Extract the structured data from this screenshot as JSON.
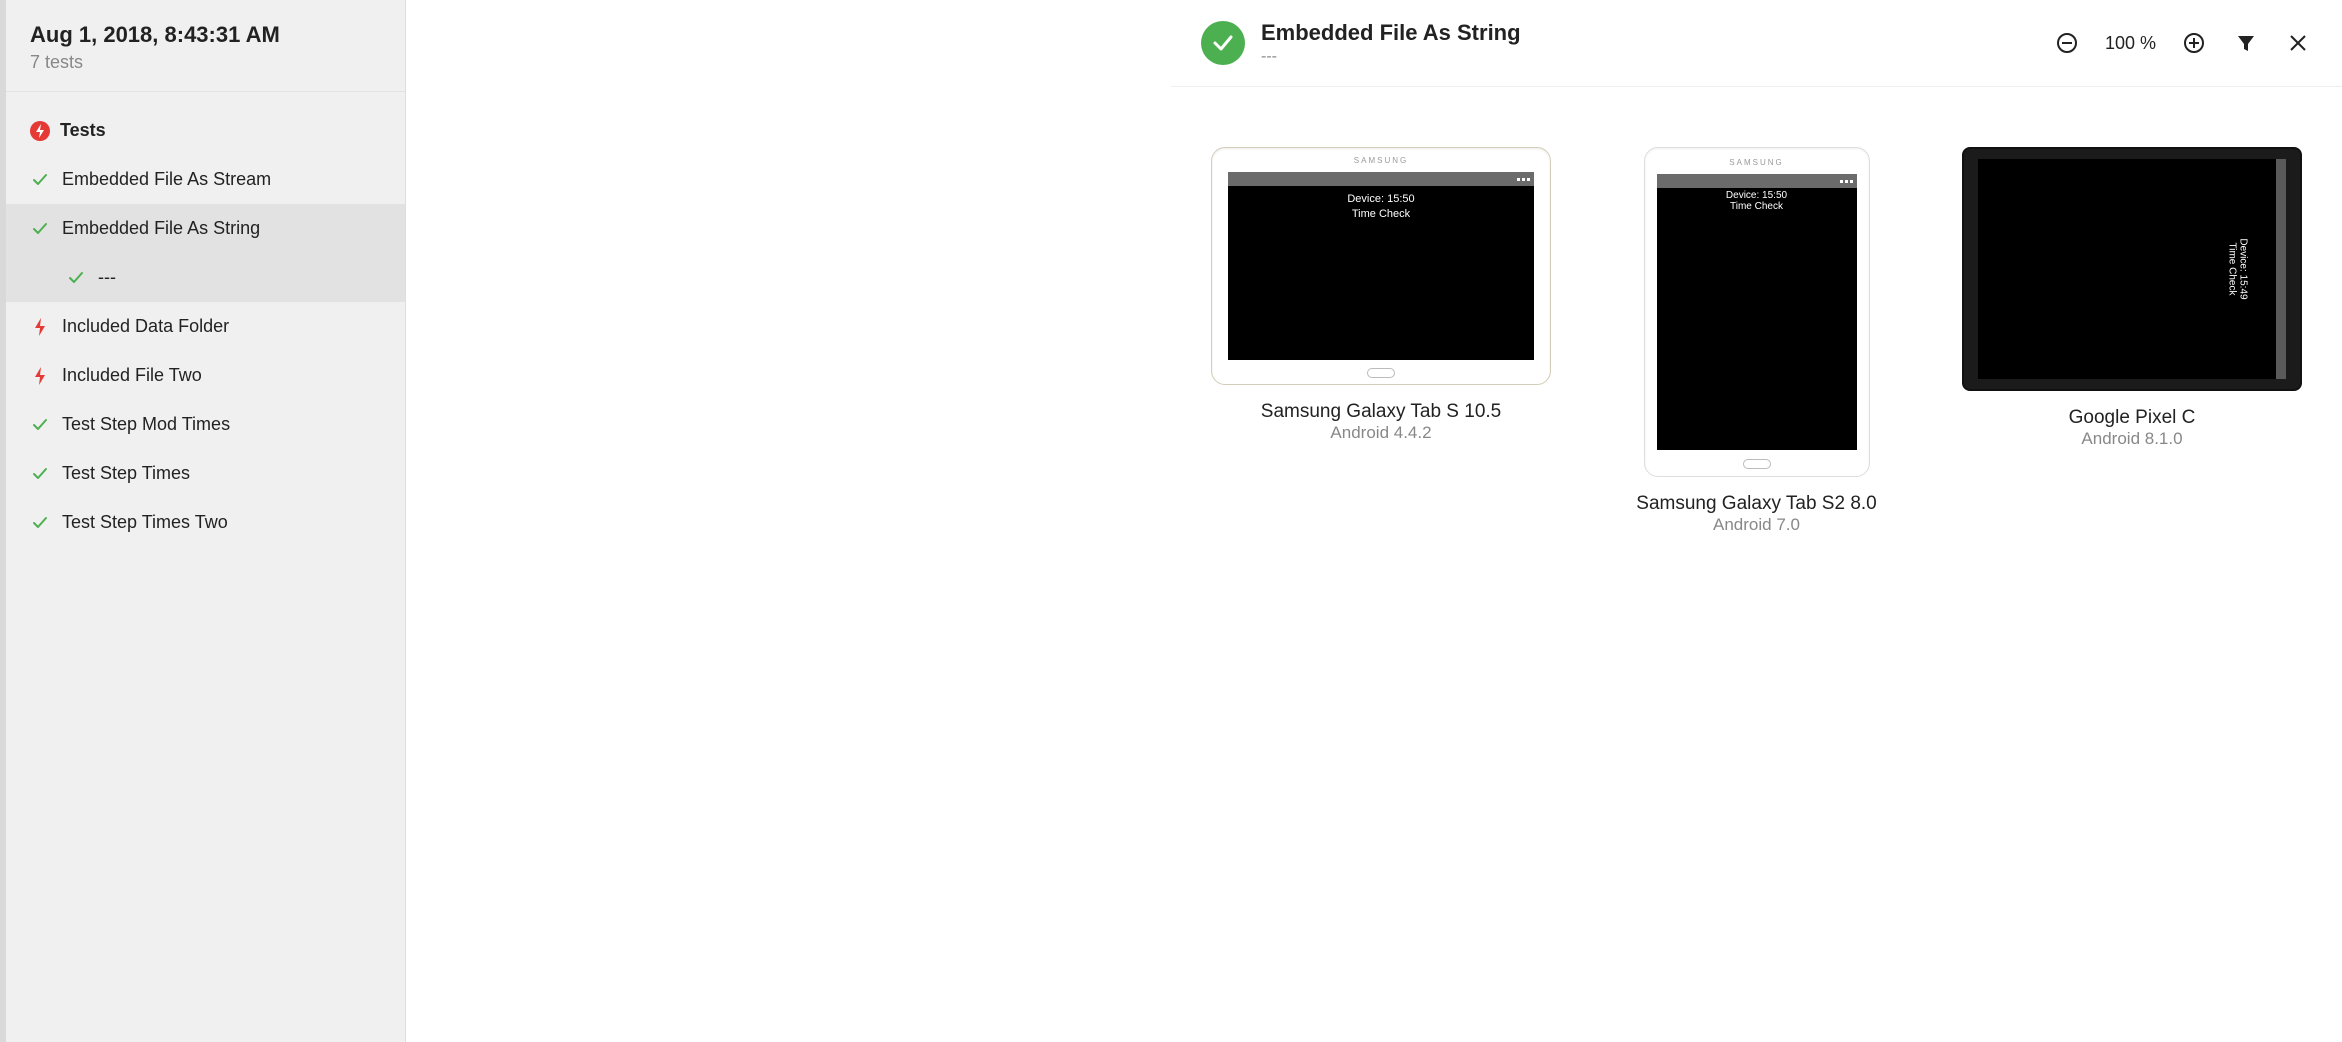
{
  "sidebar": {
    "date": "Aug 1, 2018, 8:43:31 AM",
    "subtitle": "7 tests",
    "sectionTitle": "Tests",
    "items": [
      {
        "label": "Embedded File As Stream",
        "status": "pass"
      },
      {
        "label": "Embedded File As String",
        "status": "pass",
        "selected": true
      },
      {
        "label": "---",
        "status": "pass",
        "sub": true
      },
      {
        "label": "Included Data Folder",
        "status": "fail"
      },
      {
        "label": "Included File Two",
        "status": "fail"
      },
      {
        "label": "Test Step Mod Times",
        "status": "pass"
      },
      {
        "label": "Test Step Times",
        "status": "pass"
      },
      {
        "label": "Test Step Times Two",
        "status": "pass"
      }
    ]
  },
  "topbar": {
    "title": "Embedded File As String",
    "subtitle": "---",
    "zoom": "100 %"
  },
  "devices": [
    {
      "name": "Samsung Galaxy Tab S 10.5",
      "os": "Android 4.4.2",
      "brand": "SAMSUNG",
      "screenLine1": "Device: 15:50",
      "screenLine2": "Time Check",
      "form": "landscape-white"
    },
    {
      "name": "Samsung Galaxy Tab S2 8.0",
      "os": "Android 7.0",
      "brand": "SAMSUNG",
      "screenLine1": "Device: 15:50",
      "screenLine2": "Time Check",
      "form": "portrait-white"
    },
    {
      "name": "Google Pixel C",
      "os": "Android 8.1.0",
      "brand": "",
      "screenLine1": "Device: 15:49",
      "screenLine2": "Time Check",
      "form": "landscape-dark"
    }
  ]
}
